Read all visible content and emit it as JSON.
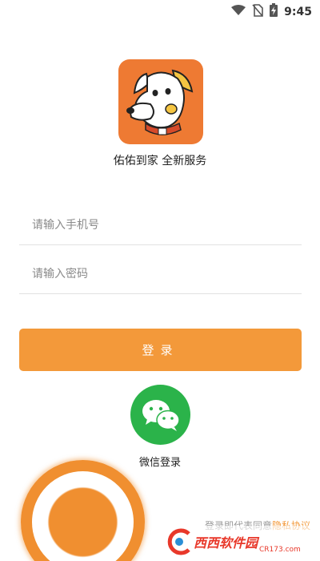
{
  "status_bar": {
    "time": "9:45",
    "icons": [
      "wifi-icon",
      "no-sim-icon",
      "battery-charging-icon"
    ]
  },
  "app": {
    "logo": "dog-logo",
    "tagline": "佑佑到家 全新服务"
  },
  "form": {
    "phone_placeholder": "请输入手机号",
    "password_placeholder": "请输入密码",
    "login_label": "登录"
  },
  "wechat": {
    "label": "微信登录",
    "icon": "wechat-icon"
  },
  "agreement": {
    "text": "登录即代表同意",
    "link": "隐私协议"
  },
  "watermark": {
    "brand": "西西软件园",
    "domain": "CR173.com"
  },
  "colors": {
    "accent": "#f3993a",
    "logo_bg": "#ee7a33",
    "wechat": "#2bb34a"
  }
}
